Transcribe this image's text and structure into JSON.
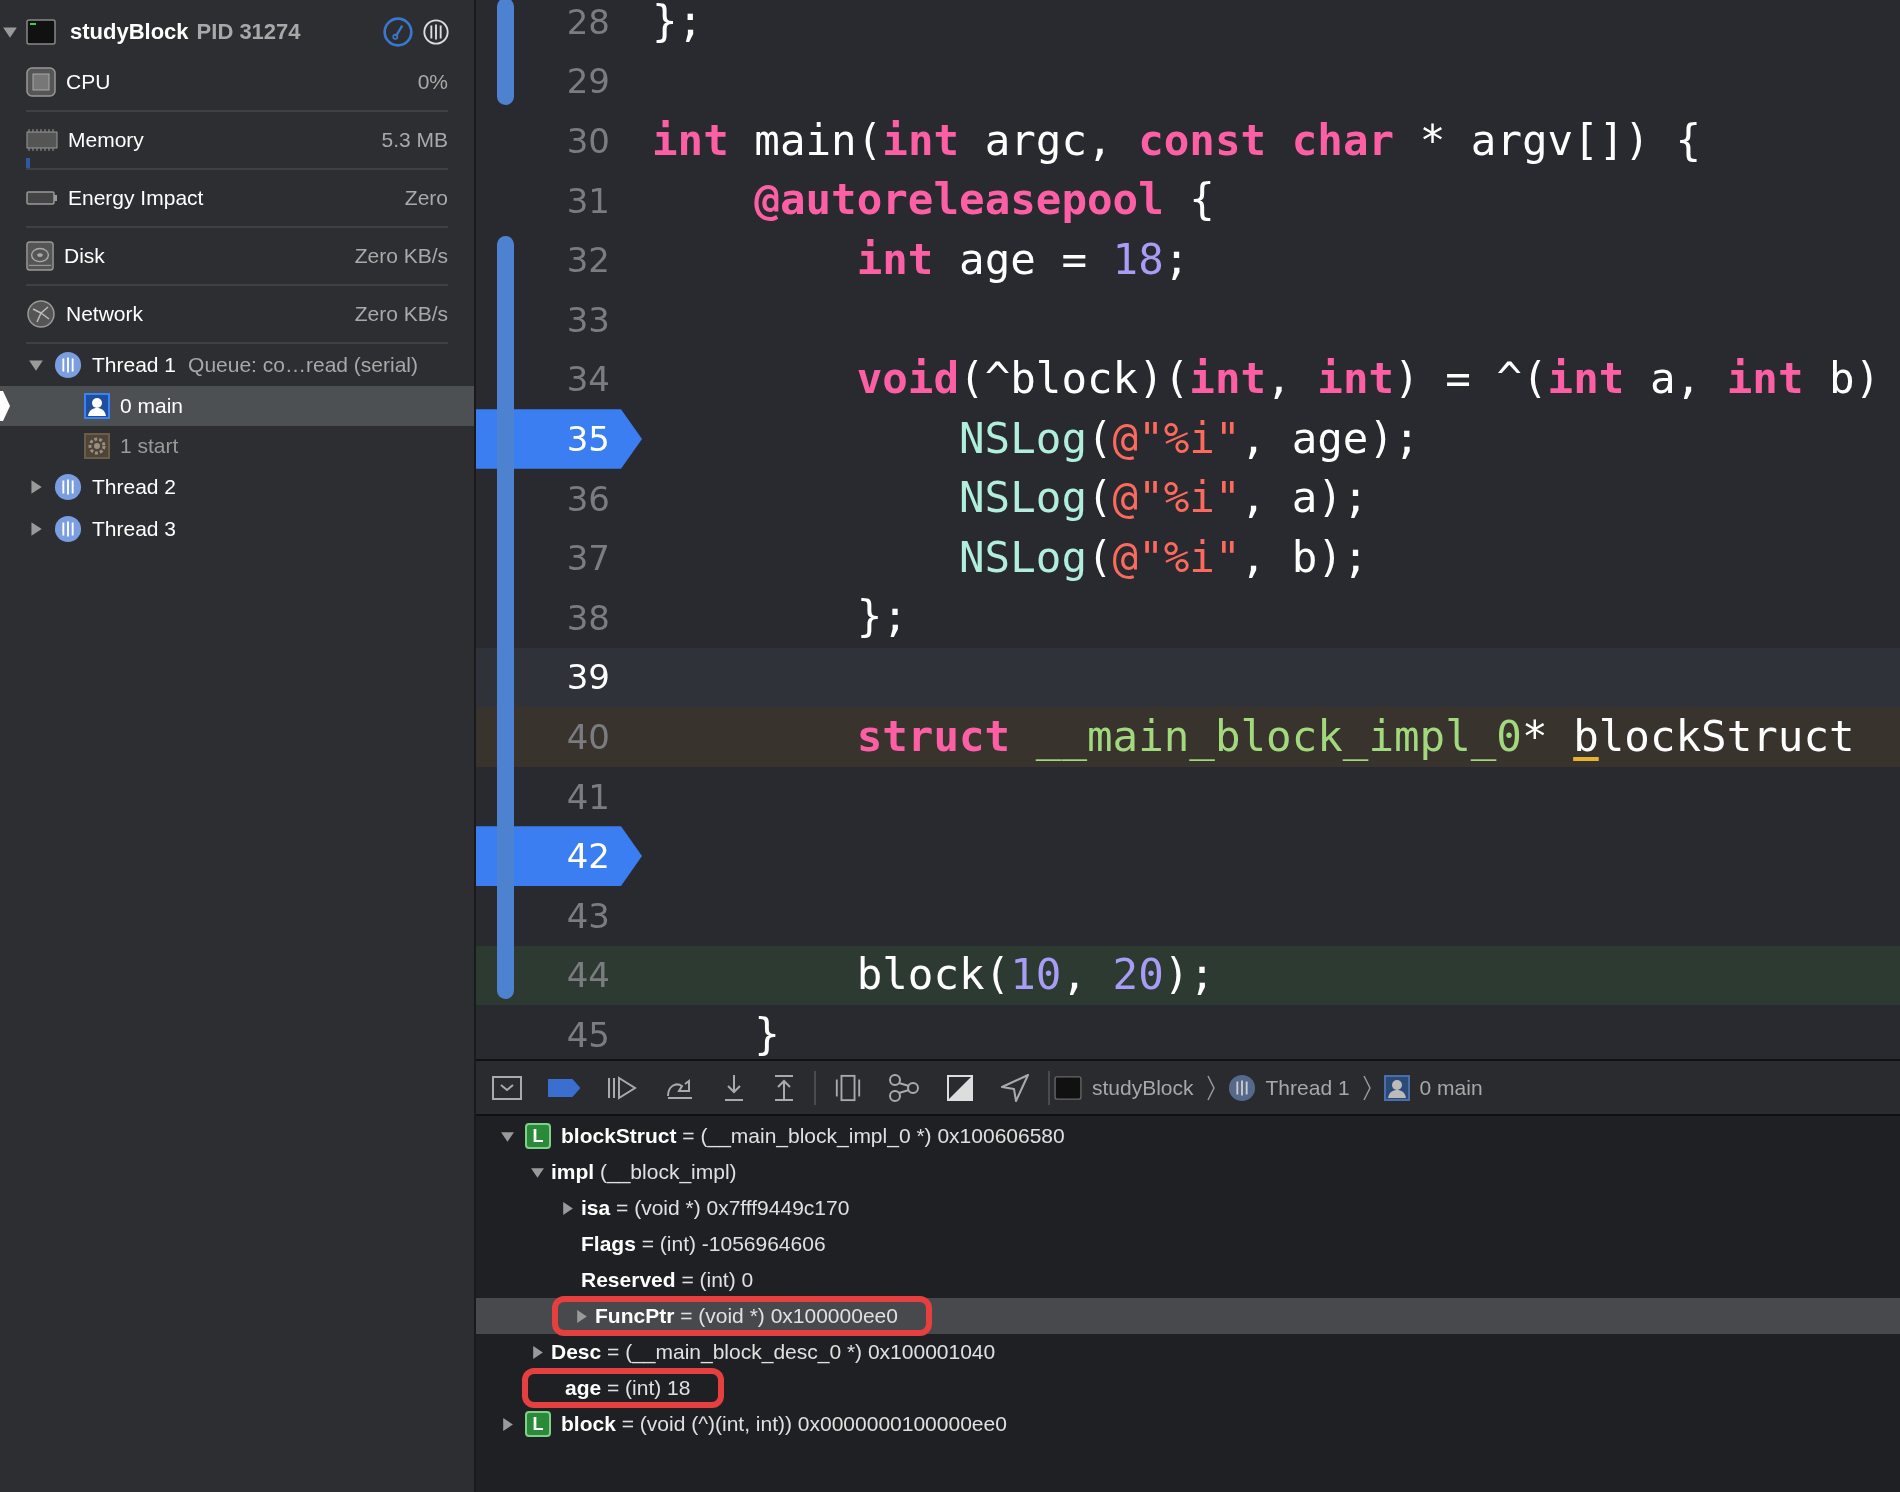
{
  "navigator": {
    "process": {
      "name": "studyBlock",
      "pid": "PID 31274",
      "expanded": true
    },
    "gauges": [
      {
        "kind": "cpu",
        "label": "CPU",
        "value": "0%"
      },
      {
        "kind": "memory",
        "label": "Memory",
        "value": "5.3 MB",
        "level": 0.01
      },
      {
        "kind": "energy",
        "label": "Energy Impact",
        "value": "Zero"
      },
      {
        "kind": "disk",
        "label": "Disk",
        "value": "Zero KB/s"
      },
      {
        "kind": "network",
        "label": "Network",
        "value": "Zero KB/s"
      }
    ],
    "threads": [
      {
        "label": "Thread 1",
        "queue": "Queue: co…read (serial)",
        "expanded": true,
        "frames": [
          {
            "label": "0 main",
            "kind": "user",
            "selected": true
          },
          {
            "label": "1 start",
            "kind": "system",
            "selected": false
          }
        ]
      },
      {
        "label": "Thread 2",
        "expanded": false
      },
      {
        "label": "Thread 3",
        "expanded": false
      }
    ]
  },
  "editor": {
    "lines": [
      {
        "number": "28",
        "changed": true,
        "breakpoint": false,
        "tokens": [
          {
            "text": "};",
            "kind": "plain"
          }
        ]
      },
      {
        "number": "29",
        "changed": true,
        "breakpoint": false
      },
      {
        "number": "30",
        "changed": false,
        "breakpoint": false,
        "tokens": [
          {
            "text": "int",
            "kind": "keyword"
          },
          {
            "text": " main(",
            "kind": "plain"
          },
          {
            "text": "int",
            "kind": "keyword"
          },
          {
            "text": " argc, ",
            "kind": "plain"
          },
          {
            "text": "const",
            "kind": "keyword"
          },
          {
            "text": " char",
            "kind": "keyword"
          },
          {
            "text": " * argv[]) {",
            "kind": "plain"
          }
        ]
      },
      {
        "number": "31",
        "changed": false,
        "breakpoint": false,
        "tokens": [
          {
            "text": "    @autoreleasepool",
            "kind": "keyword"
          },
          {
            "text": " {",
            "kind": "plain"
          }
        ]
      },
      {
        "number": "32",
        "changed": true,
        "breakpoint": false,
        "tokens": [
          {
            "text": "        int",
            "kind": "keyword"
          },
          {
            "text": " age = ",
            "kind": "plain"
          },
          {
            "text": "18",
            "kind": "number"
          },
          {
            "text": ";",
            "kind": "plain"
          }
        ]
      },
      {
        "number": "33",
        "changed": true,
        "breakpoint": false
      },
      {
        "number": "34",
        "changed": true,
        "breakpoint": false,
        "tokens": [
          {
            "text": "        void",
            "kind": "keyword"
          },
          {
            "text": "(^block)(",
            "kind": "plain"
          },
          {
            "text": "int",
            "kind": "keyword"
          },
          {
            "text": ", ",
            "kind": "plain"
          },
          {
            "text": "int",
            "kind": "keyword"
          },
          {
            "text": ") = ^(",
            "kind": "plain"
          },
          {
            "text": "int",
            "kind": "keyword"
          },
          {
            "text": " a, ",
            "kind": "plain"
          },
          {
            "text": "int",
            "kind": "keyword"
          },
          {
            "text": " b)",
            "kind": "plain"
          }
        ]
      },
      {
        "number": "35",
        "changed": true,
        "breakpoint": true,
        "tokens": [
          {
            "text": "            NSLog",
            "kind": "function"
          },
          {
            "text": "(",
            "kind": "plain"
          },
          {
            "text": "@\"%i\"",
            "kind": "string"
          },
          {
            "text": ", age);",
            "kind": "plain"
          }
        ]
      },
      {
        "number": "36",
        "changed": true,
        "breakpoint": false,
        "tokens": [
          {
            "text": "            NSLog",
            "kind": "function"
          },
          {
            "text": "(",
            "kind": "plain"
          },
          {
            "text": "@\"%i\"",
            "kind": "string"
          },
          {
            "text": ", a);",
            "kind": "plain"
          }
        ]
      },
      {
        "number": "37",
        "changed": true,
        "breakpoint": false,
        "tokens": [
          {
            "text": "            NSLog",
            "kind": "function"
          },
          {
            "text": "(",
            "kind": "plain"
          },
          {
            "text": "@\"%i\"",
            "kind": "string"
          },
          {
            "text": ", b);",
            "kind": "plain"
          }
        ]
      },
      {
        "number": "38",
        "changed": true,
        "breakpoint": false,
        "tokens": [
          {
            "text": "        };",
            "kind": "plain"
          }
        ]
      },
      {
        "number": "39",
        "changed": true,
        "breakpoint": false,
        "color": "#2f3239"
      },
      {
        "number": "40",
        "changed": true,
        "breakpoint": false,
        "color": "#38332d",
        "tokens": [
          {
            "text": "        struct",
            "kind": "keyword"
          },
          {
            "text": " __main_block_impl_0",
            "kind": "type"
          },
          {
            "text": "* ",
            "kind": "plain"
          },
          {
            "text": "b",
            "kind": "marked"
          },
          {
            "text": "lockStruct",
            "kind": "plain"
          }
        ]
      },
      {
        "number": "41",
        "changed": true,
        "breakpoint": false
      },
      {
        "number": "42",
        "changed": true,
        "breakpoint": true
      },
      {
        "number": "43",
        "changed": true,
        "breakpoint": false
      },
      {
        "number": "44",
        "changed": true,
        "breakpoint": false,
        "color": "#2d3a31",
        "tokens": [
          {
            "text": "        block(",
            "kind": "plain"
          },
          {
            "text": "10",
            "kind": "number"
          },
          {
            "text": ", ",
            "kind": "plain"
          },
          {
            "text": "20",
            "kind": "number"
          },
          {
            "text": ");",
            "kind": "plain"
          }
        ]
      },
      {
        "number": "45",
        "changed": false,
        "breakpoint": false,
        "tokens": [
          {
            "text": "    }",
            "kind": "plain"
          }
        ]
      }
    ]
  },
  "debug_bar": {
    "breakpoints_active": true,
    "breadcrumb": [
      {
        "kind": "app",
        "label": "studyBlock"
      },
      {
        "kind": "thread",
        "label": "Thread 1"
      },
      {
        "kind": "frame",
        "label": "0 main"
      }
    ]
  },
  "variables": [
    {
      "text": "**blockStruct** = (__main_block_impl_0 *) 0x100606580",
      "badge": "L",
      "expandable": true,
      "expanded": true,
      "selected": false,
      "annotated": false,
      "children": [
        {
          "text": "**impl** (__block_impl)",
          "expandable": true,
          "expanded": true,
          "selected": false,
          "annotated": false,
          "children": [
            {
              "text": "**isa** = (void *) 0x7fff9449c170",
              "expandable": true,
              "expanded": false,
              "selected": false,
              "annotated": false
            },
            {
              "text": "**Flags** = (int) -1056964606",
              "expandable": false,
              "expanded": false,
              "selected": false,
              "annotated": false
            },
            {
              "text": "**Reserved** = (int) 0",
              "expandable": false,
              "expanded": false,
              "selected": false,
              "annotated": false
            },
            {
              "text": "**FuncPtr** = (void *) 0x100000ee0",
              "expandable": true,
              "expanded": false,
              "selected": true,
              "annotated": true
            }
          ]
        },
        {
          "text": "**Desc** = (__main_block_desc_0 *) 0x100001040",
          "expandable": true,
          "expanded": false,
          "selected": false,
          "annotated": false
        },
        {
          "text": "**age** = (int) 18",
          "expandable": false,
          "expanded": false,
          "selected": false,
          "annotated": true
        }
      ]
    },
    {
      "text": "**block** = (void (^)(int, int)) 0x0000000100000ee0",
      "badge": "L",
      "expandable": true,
      "expanded": false,
      "selected": false,
      "annotated": false
    }
  ]
}
